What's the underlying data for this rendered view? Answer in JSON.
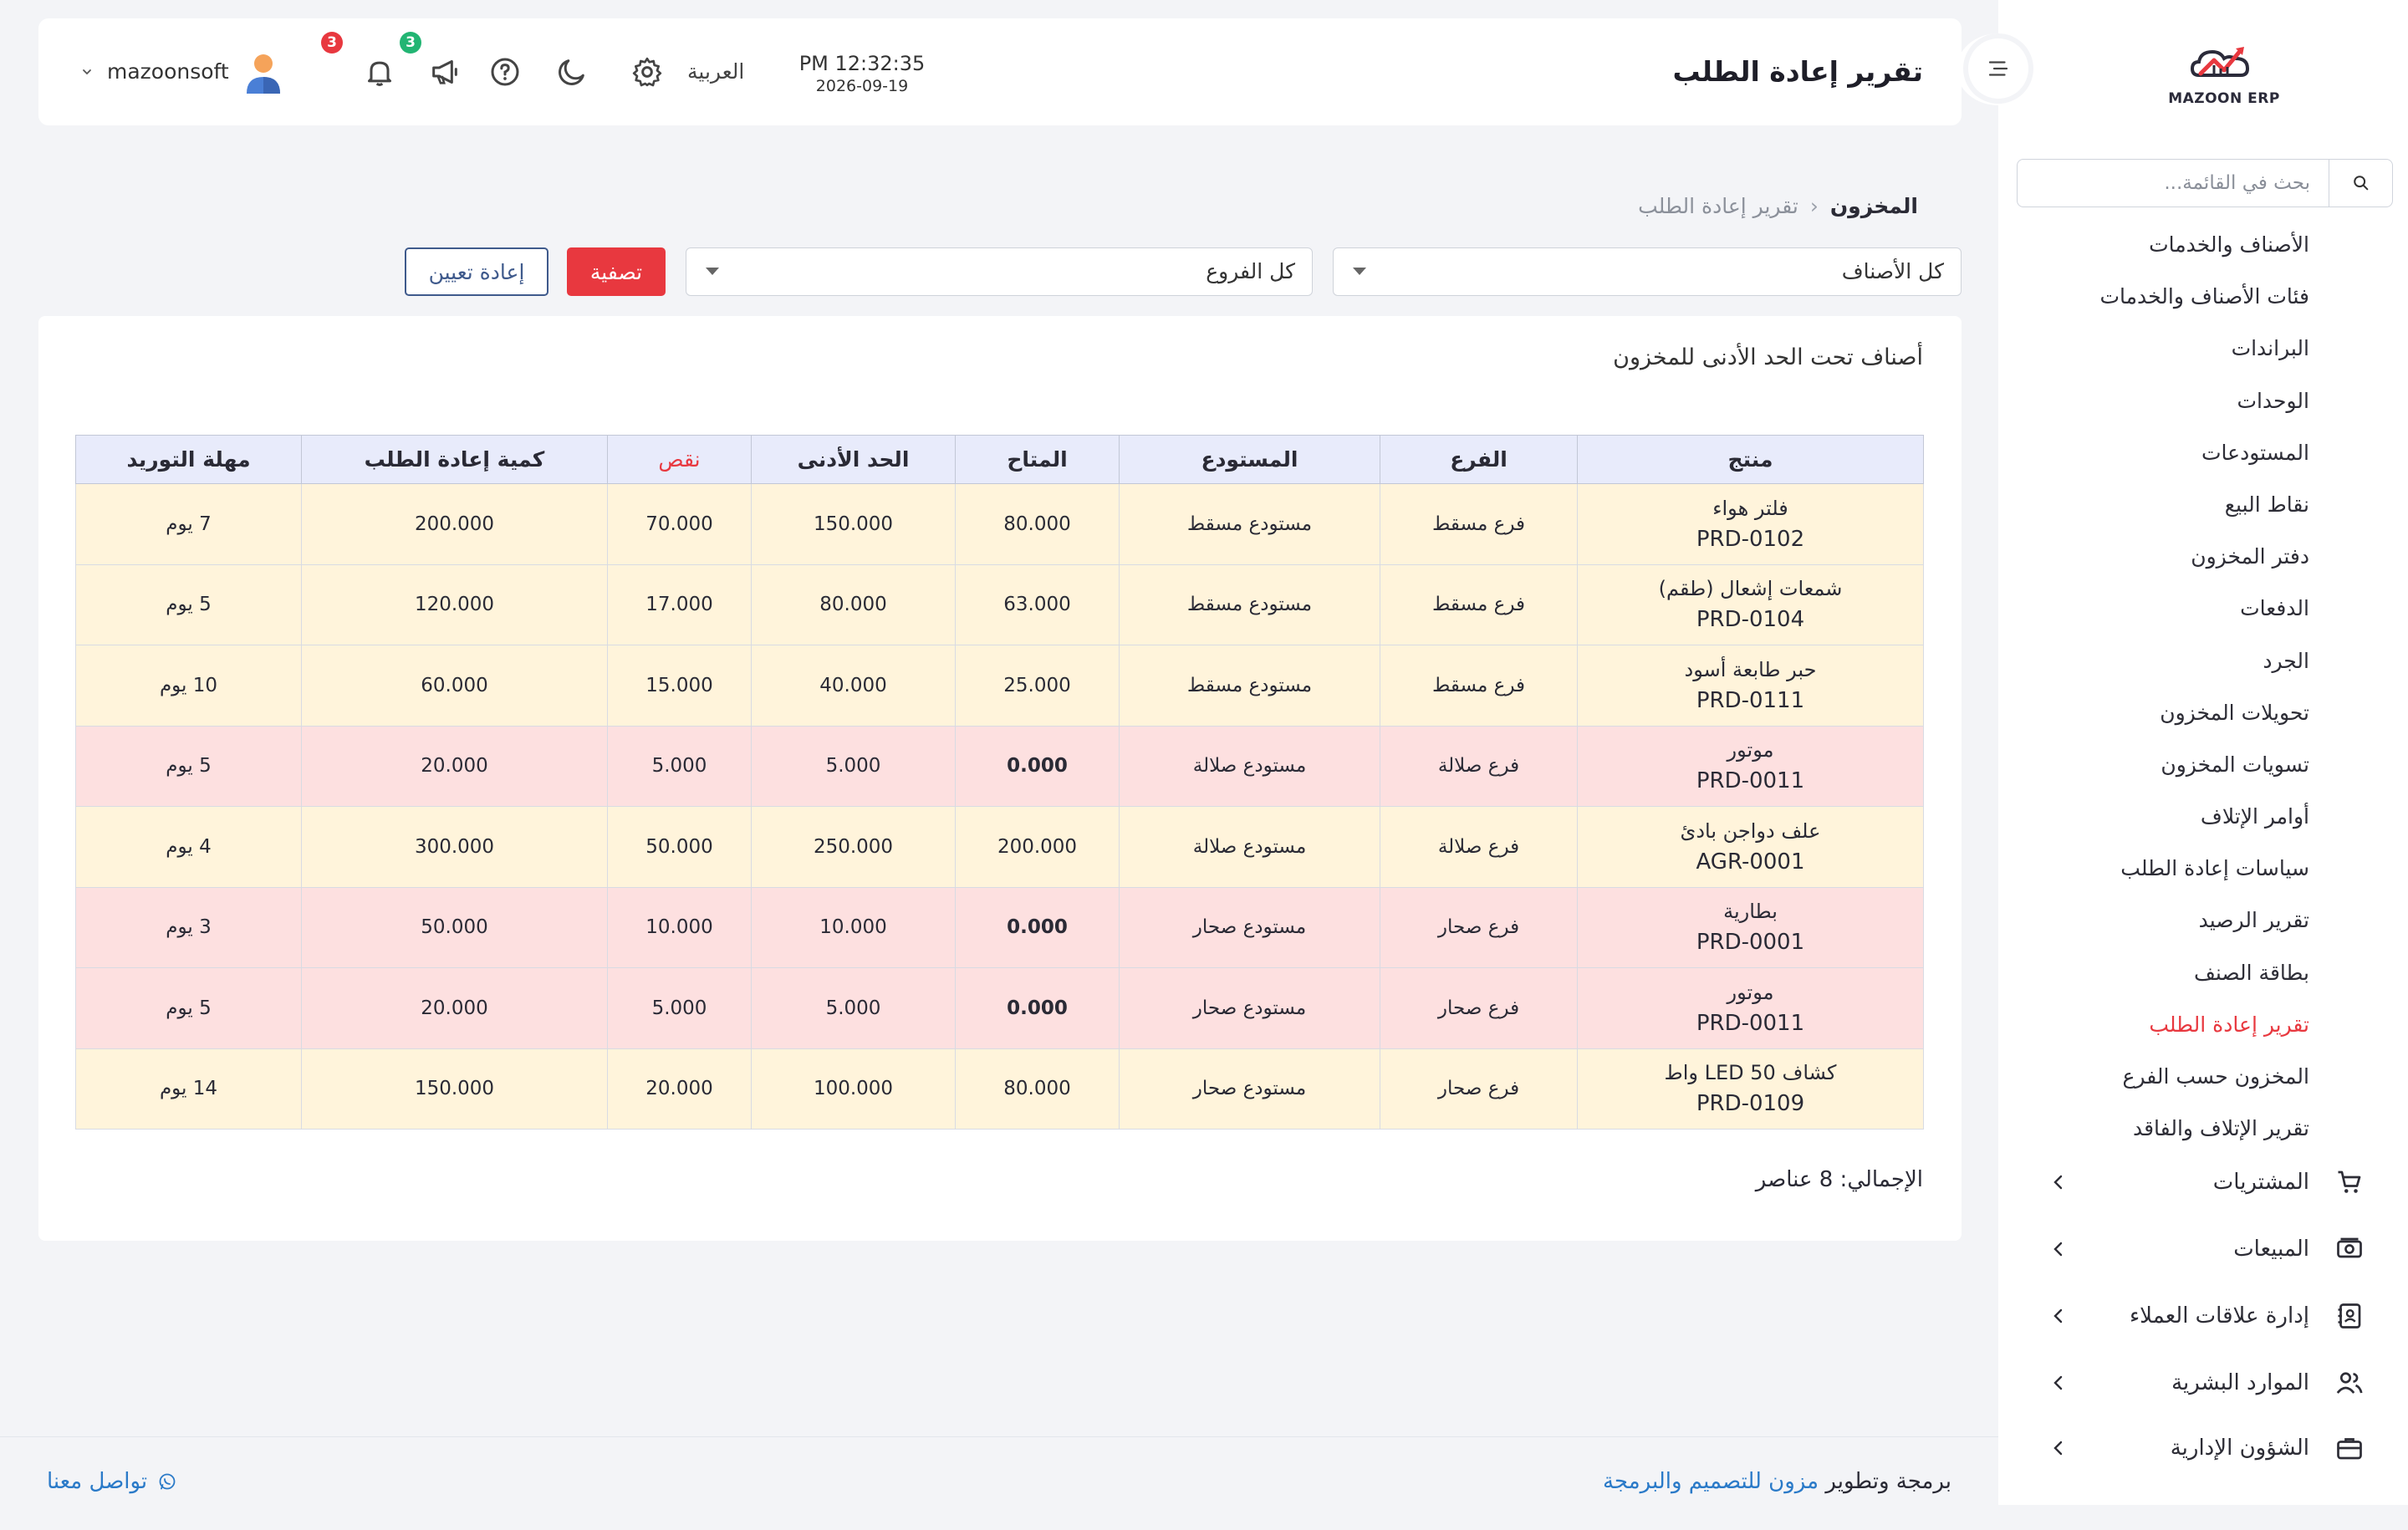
{
  "brand": {
    "logo_text": "MAZOON ERP"
  },
  "sidebar": {
    "search_placeholder": "بحث في القائمة...",
    "items": [
      {
        "label": "الأصناف والخدمات"
      },
      {
        "label": "فئات الأصناف والخدمات"
      },
      {
        "label": "البراندات"
      },
      {
        "label": "الوحدات"
      },
      {
        "label": "المستودعات"
      },
      {
        "label": "نقاط البيع"
      },
      {
        "label": "دفتر المخزون"
      },
      {
        "label": "الدفعات"
      },
      {
        "label": "الجرد"
      },
      {
        "label": "تحويلات المخزون"
      },
      {
        "label": "تسويات المخزون"
      },
      {
        "label": "أوامر الإتلاف"
      },
      {
        "label": "سياسات إعادة الطلب"
      },
      {
        "label": "تقرير الرصيد"
      },
      {
        "label": "بطاقة الصنف"
      },
      {
        "label": "تقرير إعادة الطلب"
      },
      {
        "label": "المخزون حسب الفرع"
      },
      {
        "label": "تقرير الإتلاف والفاقد"
      }
    ],
    "active_index": 15,
    "groups": [
      {
        "label": "المشتريات",
        "icon": "cart-icon"
      },
      {
        "label": "المبيعات",
        "icon": "cash-icon"
      },
      {
        "label": "إدارة علاقات العملاء",
        "icon": "contacts-book-icon"
      },
      {
        "label": "الموارد البشرية",
        "icon": "users-icon"
      },
      {
        "label": "الشؤون الإدارية",
        "icon": "briefcase-icon"
      }
    ]
  },
  "header": {
    "title": "تقرير إعادة الطلب",
    "time": "PM 12:32:35",
    "date": "2026-09-19",
    "language": "العربية",
    "notifications_count": "3",
    "announcements_count": "3",
    "username": "mazoonsoft"
  },
  "breadcrumb": {
    "parent": "المخزون",
    "current": "تقرير إعادة الطلب"
  },
  "filters": {
    "category": "كل الأصناف",
    "branch": "كل الفروع",
    "filter_label": "تصفية",
    "reset_label": "إعادة تعيين"
  },
  "report": {
    "title": "أصناف تحت الحد الأدنى للمخزون",
    "columns": [
      "منتج",
      "الفرع",
      "المستودع",
      "المتاح",
      "الحد الأدنى",
      "نقص",
      "كمية إعادة الطلب",
      "مهلة التوريد"
    ],
    "rows": [
      {
        "name": "فلتر هواء",
        "code": "PRD-0102",
        "branch": "فرع مسقط",
        "warehouse": "مستودع مسقط",
        "available": "80.000",
        "min": "150.000",
        "shortage": "70.000",
        "reorder_qty": "200.000",
        "lead_time": "7 يوم",
        "status": "warn"
      },
      {
        "name": "شمعات إشعال (طقم)",
        "code": "PRD-0104",
        "branch": "فرع مسقط",
        "warehouse": "مستودع مسقط",
        "available": "63.000",
        "min": "80.000",
        "shortage": "17.000",
        "reorder_qty": "120.000",
        "lead_time": "5 يوم",
        "status": "warn"
      },
      {
        "name": "حبر طابعة أسود",
        "code": "PRD-0111",
        "branch": "فرع مسقط",
        "warehouse": "مستودع مسقط",
        "available": "25.000",
        "min": "40.000",
        "shortage": "15.000",
        "reorder_qty": "60.000",
        "lead_time": "10 يوم",
        "status": "warn"
      },
      {
        "name": "موتور",
        "code": "PRD-0011",
        "branch": "فرع صلالة",
        "warehouse": "مستودع صلالة",
        "available": "0.000",
        "min": "5.000",
        "shortage": "5.000",
        "reorder_qty": "20.000",
        "lead_time": "5 يوم",
        "status": "crit"
      },
      {
        "name": "علف دواجن بادئ",
        "code": "AGR-0001",
        "branch": "فرع صلالة",
        "warehouse": "مستودع صلالة",
        "available": "200.000",
        "min": "250.000",
        "shortage": "50.000",
        "reorder_qty": "300.000",
        "lead_time": "4 يوم",
        "status": "warn"
      },
      {
        "name": "بطارية",
        "code": "PRD-0001",
        "branch": "فرع صحار",
        "warehouse": "مستودع صحار",
        "available": "0.000",
        "min": "10.000",
        "shortage": "10.000",
        "reorder_qty": "50.000",
        "lead_time": "3 يوم",
        "status": "crit"
      },
      {
        "name": "موتور",
        "code": "PRD-0011",
        "branch": "فرع صحار",
        "warehouse": "مستودع صحار",
        "available": "0.000",
        "min": "5.000",
        "shortage": "5.000",
        "reorder_qty": "20.000",
        "lead_time": "5 يوم",
        "status": "crit"
      },
      {
        "name": "كشاف LED 50 واط",
        "code": "PRD-0109",
        "branch": "فرع صحار",
        "warehouse": "مستودع صحار",
        "available": "80.000",
        "min": "100.000",
        "shortage": "20.000",
        "reorder_qty": "150.000",
        "lead_time": "14 يوم",
        "status": "warn"
      }
    ],
    "total": "الإجمالي: 8 عناصر"
  },
  "footer": {
    "credit_prefix": "برمجة وتطوير",
    "credit_link": "مزون للتصميم والبرمجة",
    "contact": "تواصل معنا"
  },
  "colors": {
    "accent": "#e8383f",
    "warn_row": "#fff4db",
    "critical_row": "#fde0e0",
    "header_row": "#e8ebfb",
    "link": "#2a7ac8"
  }
}
